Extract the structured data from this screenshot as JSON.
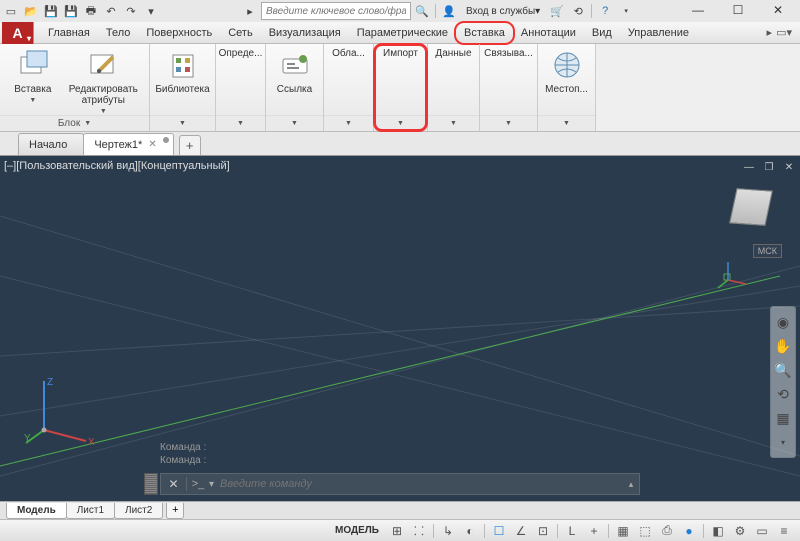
{
  "titlebar": {
    "search_placeholder": "Введите ключевое слово/фразу",
    "signin_label": "Вход в службы"
  },
  "menubar": {
    "items": [
      "Главная",
      "Тело",
      "Поверхность",
      "Сеть",
      "Визуализация",
      "Параметрические",
      "Вставка",
      "Аннотации",
      "Вид",
      "Управление"
    ]
  },
  "ribbon": {
    "panels": {
      "block": {
        "insert": "Вставка",
        "editattr": "Редактировать\nатрибуты",
        "footer": "Блок"
      },
      "library": {
        "label": "Библиотека"
      },
      "define": {
        "label": "Опреде..."
      },
      "link": {
        "label": "Ссылка"
      },
      "cloud": {
        "label": "Обла..."
      },
      "import": {
        "label": "Импорт"
      },
      "data": {
        "label": "Данные"
      },
      "bind": {
        "label": "Связыва..."
      },
      "geo": {
        "label": "Местоп..."
      }
    }
  },
  "doc_tabs": {
    "items": [
      "Начало",
      "Чертеж1*"
    ]
  },
  "viewport": {
    "label": "[–][Пользовательский вид][Концептуальный]",
    "wcs": "МСК",
    "axes": {
      "x": "X",
      "y": "Y",
      "z": "Z"
    },
    "cmd_history1": "Команда :",
    "cmd_history2": "Команда :",
    "cmd_placeholder": "Введите команду"
  },
  "bottom_tabs": {
    "items": [
      "Модель",
      "Лист1",
      "Лист2"
    ]
  },
  "statusbar": {
    "model_label": "МОДЕЛЬ"
  }
}
